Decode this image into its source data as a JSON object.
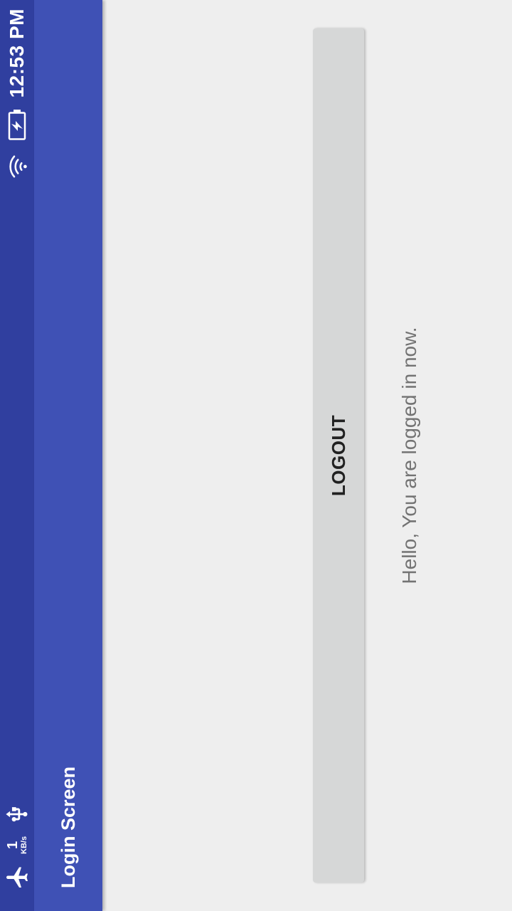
{
  "status_bar": {
    "time": "12:53 PM",
    "net_speed_value": "1",
    "net_speed_unit": "KB/s",
    "icons": [
      "airplane-icon",
      "usb-icon",
      "wifi-icon",
      "battery-charging-icon"
    ]
  },
  "app_bar": {
    "title": "Login Screen"
  },
  "main": {
    "logout_label": "LOGOUT",
    "message": "Hello, You are logged in now."
  },
  "colors": {
    "status_bar": "#303f9f",
    "app_bar": "#3f51b5",
    "background": "#eeeeee",
    "button": "#d6d7d7"
  }
}
